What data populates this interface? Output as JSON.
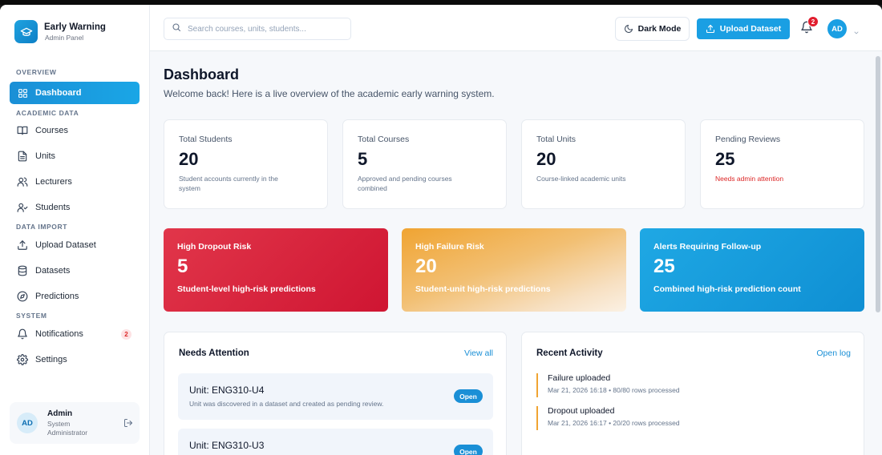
{
  "brand": {
    "title": "Early Warning",
    "subtitle": "Admin Panel"
  },
  "sidebar": {
    "sections": [
      {
        "label": "OVERVIEW"
      },
      {
        "label": "ACADEMIC DATA"
      },
      {
        "label": "DATA IMPORT"
      },
      {
        "label": "SYSTEM"
      }
    ],
    "items": [
      {
        "label": "Dashboard",
        "icon": "grid-icon",
        "active": true
      },
      {
        "label": "Courses",
        "icon": "book-icon"
      },
      {
        "label": "Units",
        "icon": "file-icon"
      },
      {
        "label": "Lecturers",
        "icon": "users-icon"
      },
      {
        "label": "Students",
        "icon": "user-check-icon"
      },
      {
        "label": "Upload Dataset",
        "icon": "upload-icon"
      },
      {
        "label": "Datasets",
        "icon": "database-icon"
      },
      {
        "label": "Predictions",
        "icon": "compass-icon"
      },
      {
        "label": "Notifications",
        "icon": "bell-icon",
        "badge": "2"
      },
      {
        "label": "Settings",
        "icon": "gear-icon"
      }
    ],
    "user": {
      "initials": "AD",
      "name": "Admin",
      "role": "System Administrator"
    }
  },
  "header": {
    "search_placeholder": "Search courses, units, students...",
    "dark_mode_label": "Dark Mode",
    "upload_label": "Upload Dataset",
    "notification_count": "2",
    "avatar_initials": "AD"
  },
  "main": {
    "title": "Dashboard",
    "subtitle": "Welcome back! Here is a live overview of the academic early warning system.",
    "stats": [
      {
        "label": "Total Students",
        "value": "20",
        "desc": "Student accounts currently in the system"
      },
      {
        "label": "Total Courses",
        "value": "5",
        "desc": "Approved and pending courses combined"
      },
      {
        "label": "Total Units",
        "value": "20",
        "desc": "Course-linked academic units"
      },
      {
        "label": "Pending Reviews",
        "value": "25",
        "desc": "Needs admin attention"
      }
    ],
    "risks": [
      {
        "label": "High Dropout Risk",
        "value": "5",
        "desc": "Student-level high-risk predictions",
        "color": "#d81f3a"
      },
      {
        "label": "High Failure Risk",
        "value": "20",
        "desc": "Student-unit high-risk predictions",
        "color": "#f0a432"
      },
      {
        "label": "Alerts Requiring Follow-up",
        "value": "25",
        "desc": "Combined high-risk prediction count",
        "color": "#1a9fe3"
      }
    ],
    "attention": {
      "title": "Needs Attention",
      "link": "View all",
      "items": [
        {
          "title": "Unit: ENG310-U4",
          "desc": "Unit was discovered in a dataset and created as pending review.",
          "action": "Open"
        },
        {
          "title": "Unit: ENG310-U3",
          "desc": "",
          "action": "Open"
        }
      ]
    },
    "activity": {
      "title": "Recent Activity",
      "link": "Open log",
      "items": [
        {
          "title": "Failure uploaded",
          "meta": "Mar 21, 2026 16:18 • 80/80 rows processed"
        },
        {
          "title": "Dropout uploaded",
          "meta": "Mar 21, 2026 16:17 • 20/20 rows processed"
        }
      ]
    }
  },
  "colors": {
    "accent": "#1a9fe3",
    "danger": "#dc2626",
    "warning": "#f0a432"
  }
}
